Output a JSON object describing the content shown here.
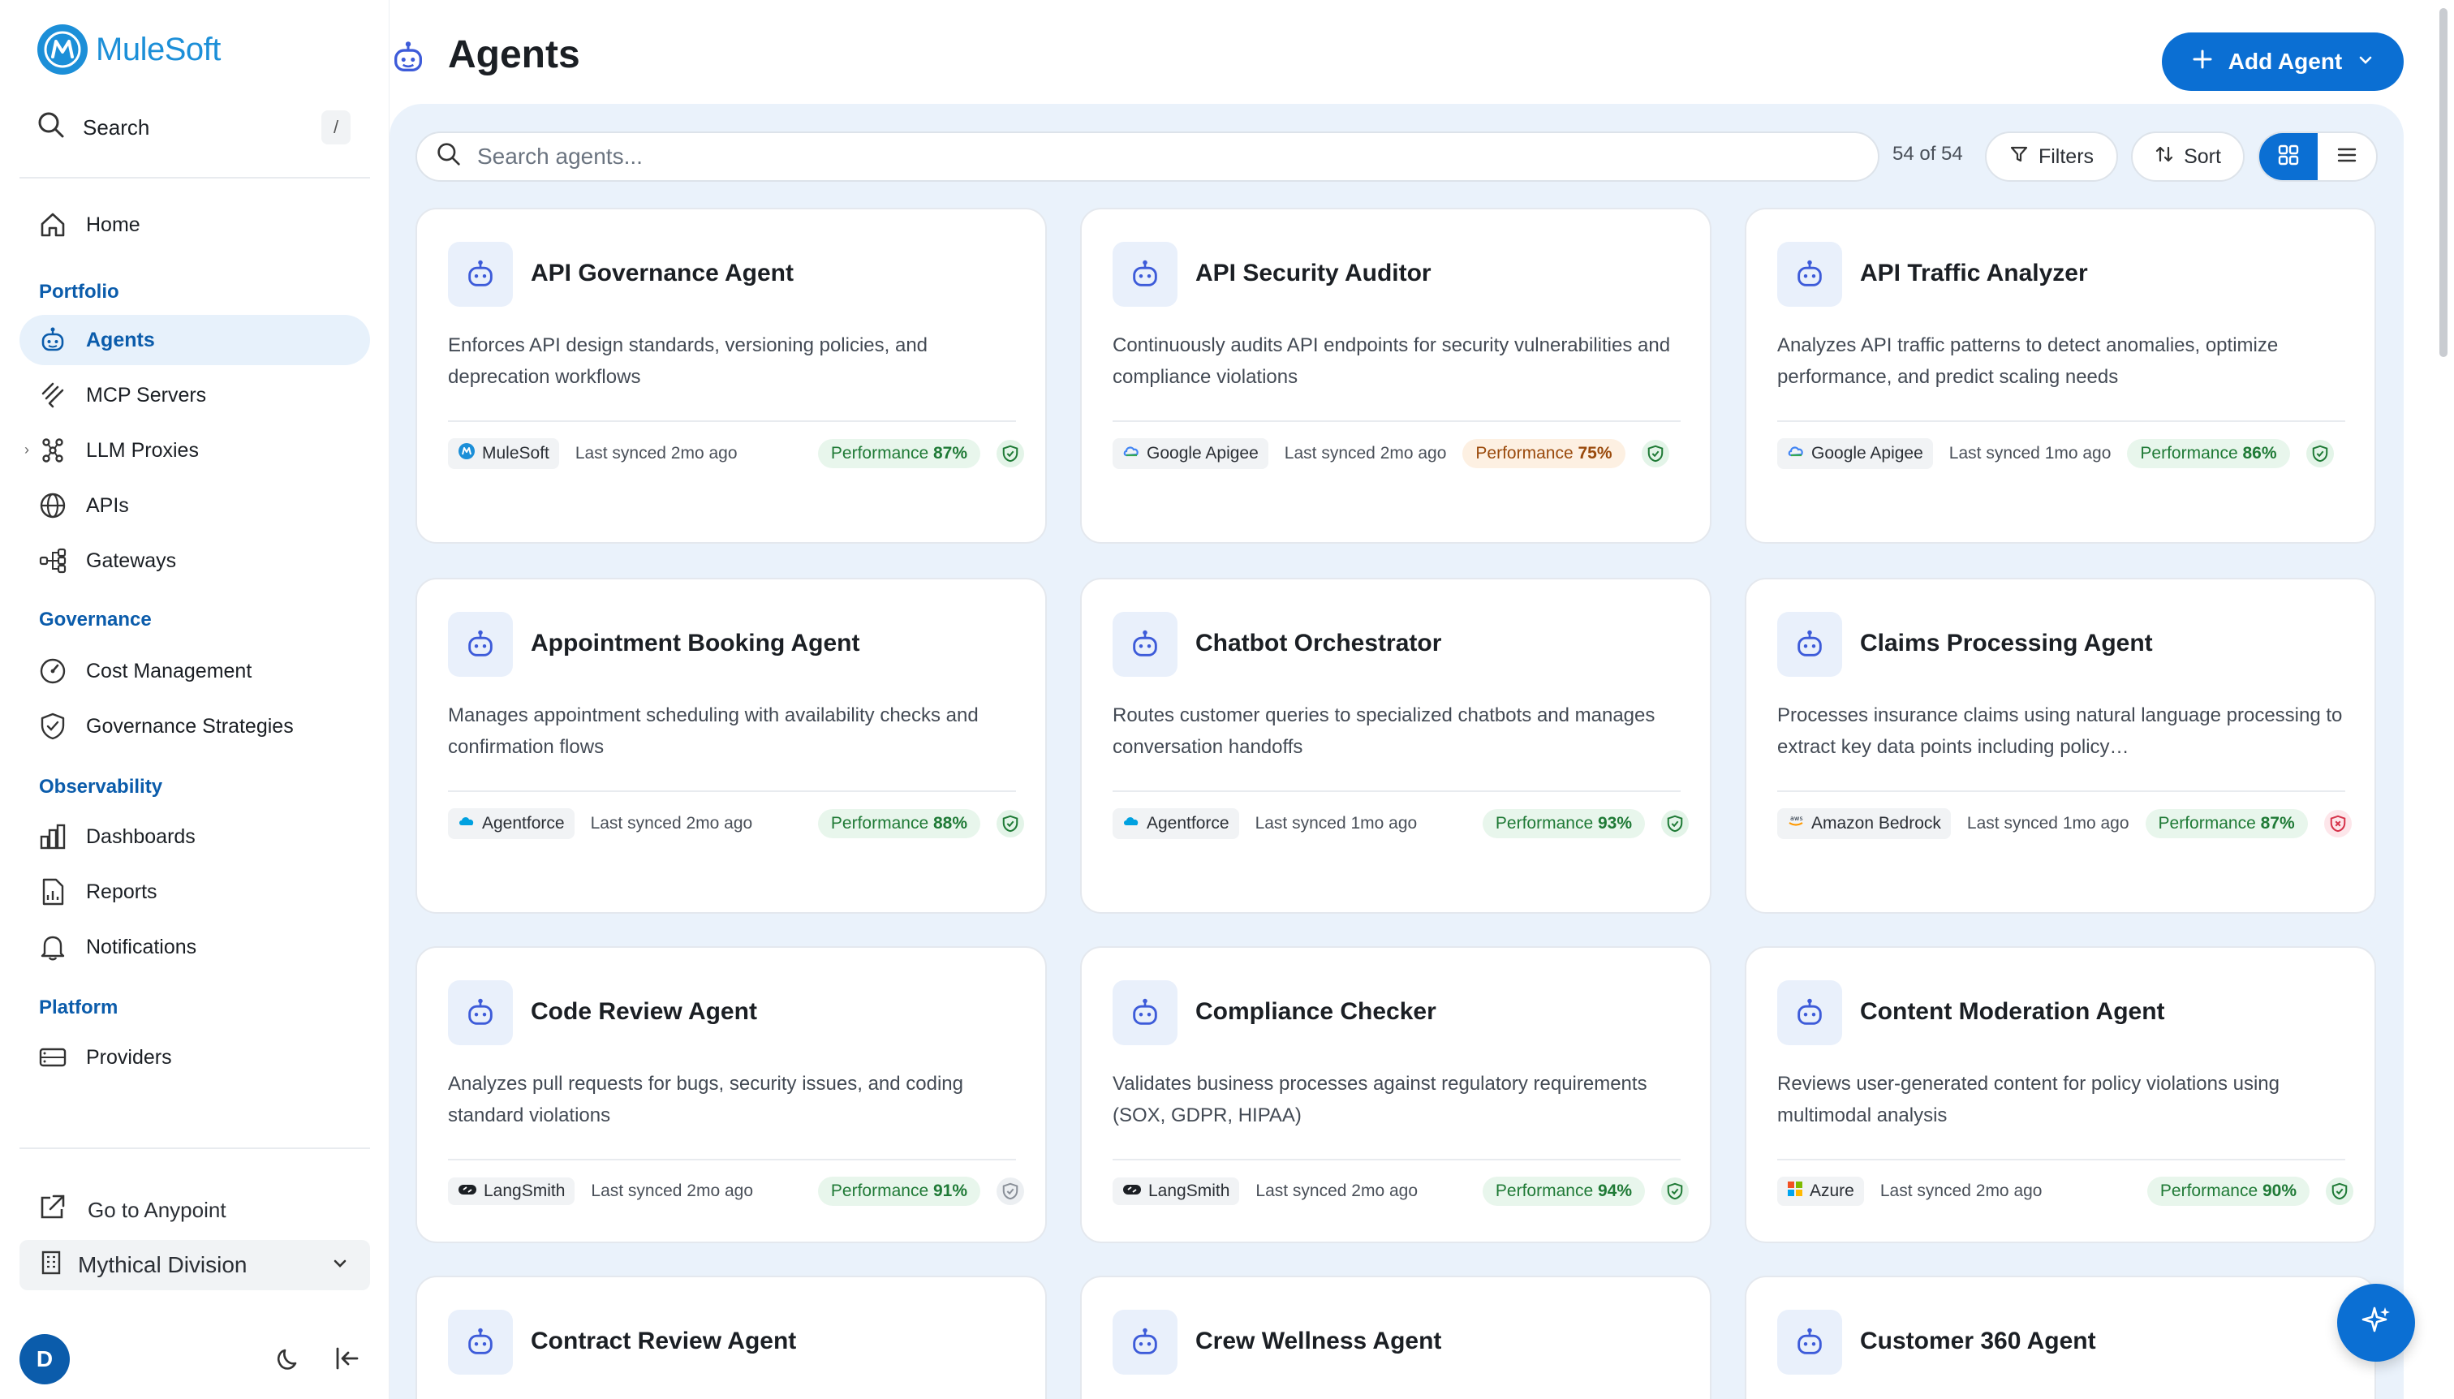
{
  "brand": {
    "name": "MuleSoft"
  },
  "sidebar": {
    "search_label": "Search",
    "search_shortcut": "/",
    "home": "Home",
    "sections": {
      "portfolio": "Portfolio",
      "governance": "Governance",
      "observability": "Observability",
      "platform": "Platform"
    },
    "items": {
      "agents": "Agents",
      "mcp_servers": "MCP Servers",
      "llm_proxies": "LLM Proxies",
      "apis": "APIs",
      "gateways": "Gateways",
      "cost_management": "Cost Management",
      "governance_strategies": "Governance Strategies",
      "dashboards": "Dashboards",
      "reports": "Reports",
      "notifications": "Notifications",
      "providers": "Providers"
    },
    "go_to_anypoint": "Go to Anypoint",
    "division": "Mythical Division",
    "user_initial": "D"
  },
  "header": {
    "title": "Agents",
    "add_button": "Add Agent"
  },
  "toolbar": {
    "search_placeholder": "Search agents...",
    "count": "54 of 54",
    "filters": "Filters",
    "sort": "Sort"
  },
  "colors": {
    "accent": "#0b6fd3",
    "active_nav_bg": "#e7f1fb",
    "panel_bg": "#eaf2fb",
    "perf_good": "#1f7a36",
    "perf_warn": "#9a4a0c"
  },
  "cards": [
    {
      "title": "API Governance Agent",
      "description": "Enforces API design standards, versioning policies, and deprecation workflows",
      "provider": "MuleSoft",
      "synced": "Last synced 2mo ago",
      "performance_label": "Performance",
      "performance": "87%",
      "performance_level": "good",
      "shield": "ok"
    },
    {
      "title": "API Security Auditor",
      "description": "Continuously audits API endpoints for security vulnerabilities and compliance violations",
      "provider": "Google Apigee",
      "synced": "Last synced 2mo ago",
      "performance_label": "Performance",
      "performance": "75%",
      "performance_level": "warn",
      "shield": "ok"
    },
    {
      "title": "API Traffic Analyzer",
      "description": "Analyzes API traffic patterns to detect anomalies, optimize performance, and predict scaling needs",
      "provider": "Google Apigee",
      "synced": "Last synced 1mo ago",
      "performance_label": "Performance",
      "performance": "86%",
      "performance_level": "good",
      "shield": "ok"
    },
    {
      "title": "Appointment Booking Agent",
      "description": "Manages appointment scheduling with availability checks and confirmation flows",
      "provider": "Agentforce",
      "synced": "Last synced 2mo ago",
      "performance_label": "Performance",
      "performance": "88%",
      "performance_level": "good",
      "shield": "ok"
    },
    {
      "title": "Chatbot Orchestrator",
      "description": "Routes customer queries to specialized chatbots and manages conversation handoffs",
      "provider": "Agentforce",
      "synced": "Last synced 1mo ago",
      "performance_label": "Performance",
      "performance": "93%",
      "performance_level": "good",
      "shield": "ok"
    },
    {
      "title": "Claims Processing Agent",
      "description": "Processes insurance claims using natural language processing to extract key data points including policy…",
      "provider": "Amazon Bedrock",
      "synced": "Last synced 1mo ago",
      "performance_label": "Performance",
      "performance": "87%",
      "performance_level": "good",
      "shield": "bad"
    },
    {
      "title": "Code Review Agent",
      "description": "Analyzes pull requests for bugs, security issues, and coding standard violations",
      "provider": "LangSmith",
      "synced": "Last synced 2mo ago",
      "performance_label": "Performance",
      "performance": "91%",
      "performance_level": "good",
      "shield": "neutral"
    },
    {
      "title": "Compliance Checker",
      "description": "Validates business processes against regulatory requirements (SOX, GDPR, HIPAA)",
      "provider": "LangSmith",
      "synced": "Last synced 2mo ago",
      "performance_label": "Performance",
      "performance": "94%",
      "performance_level": "good",
      "shield": "ok"
    },
    {
      "title": "Content Moderation Agent",
      "description": "Reviews user-generated content for policy violations using multimodal analysis",
      "provider": "Azure",
      "synced": "Last synced 2mo ago",
      "performance_label": "Performance",
      "performance": "90%",
      "performance_level": "good",
      "shield": "ok"
    },
    {
      "title": "Contract Review Agent"
    },
    {
      "title": "Crew Wellness Agent"
    },
    {
      "title": "Customer 360 Agent"
    }
  ]
}
